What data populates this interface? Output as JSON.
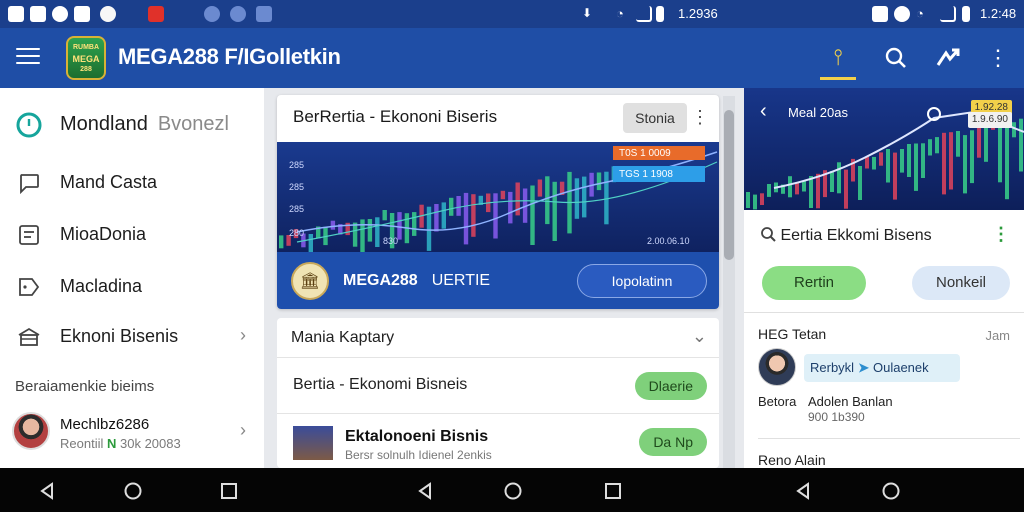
{
  "status_bar": {
    "left_time": "1.2936",
    "right_time": "1.2:48"
  },
  "app_bar": {
    "logo_lines": [
      "RUMBA",
      "MEGA",
      "288"
    ],
    "title": "MEGA288 F/IGolletkin"
  },
  "drawer": {
    "items": [
      {
        "icon": "clock-icon",
        "label": "Mondland",
        "sub": "Bvonezl"
      },
      {
        "icon": "chat-icon",
        "label": "Mand Casta",
        "sub": ""
      },
      {
        "icon": "news-icon",
        "label": "MioaDonia",
        "sub": ""
      },
      {
        "icon": "tag-icon",
        "label": "Macladina",
        "sub": ""
      },
      {
        "icon": "building-icon",
        "label": "Eknoni Bisenis",
        "sub": ""
      }
    ],
    "section_title": "Beraiamenkie bieims",
    "profile": {
      "name": "Mechlbz6286",
      "sub": "Reontiil",
      "sub_accent": "N",
      "sub_rest": "30k 20083"
    }
  },
  "main_card": {
    "title": "BerRertia - Ekononi Biseris",
    "chip": "Stonia",
    "chart_labels": {
      "y1": "285",
      "y2": "285",
      "y3": "285",
      "y4": "280",
      "x_left": "830",
      "x_right": "2.00.06.10",
      "ticker1": "T0S 1 0009",
      "ticker2": "TGS 1 1908"
    },
    "footer_title": "MEGA288",
    "footer_tag": "UERTIE",
    "footer_button": "Iopolatinn"
  },
  "list_card": {
    "header": "Mania Kaptary",
    "item1_label": "Bertia - Ekonomi Bisneis",
    "item1_pill": "Dlaerie",
    "item2_title": "Ektalonoeni Bisnis",
    "item2_sub": "Bersr solnulh Idienel 2enkis",
    "item2_pill": "Da Np"
  },
  "right_panel": {
    "chart_title": "Meal 20as",
    "badge_top": "1.92.28",
    "badge_bottom": "1.9.6.90",
    "search_text": "Eertia Ekkomi Bisens",
    "chip_left": "Rertin",
    "chip_right": "Nonkeil",
    "section_title": "HEG Tetan",
    "section_right": "Jam",
    "tag_left": "Rerbykl",
    "tag_right": "Oulaenek",
    "line_left": "Betora",
    "line_title": "Adolen Banlan",
    "line_sub": "900  1b390",
    "section2": "Reno Alain"
  },
  "colors": {
    "status_bar": "#1b3f8c",
    "app_bar": "#1f4ea6",
    "accent_green": "#7fd07b",
    "chart_bg": "#1a3a8f"
  }
}
